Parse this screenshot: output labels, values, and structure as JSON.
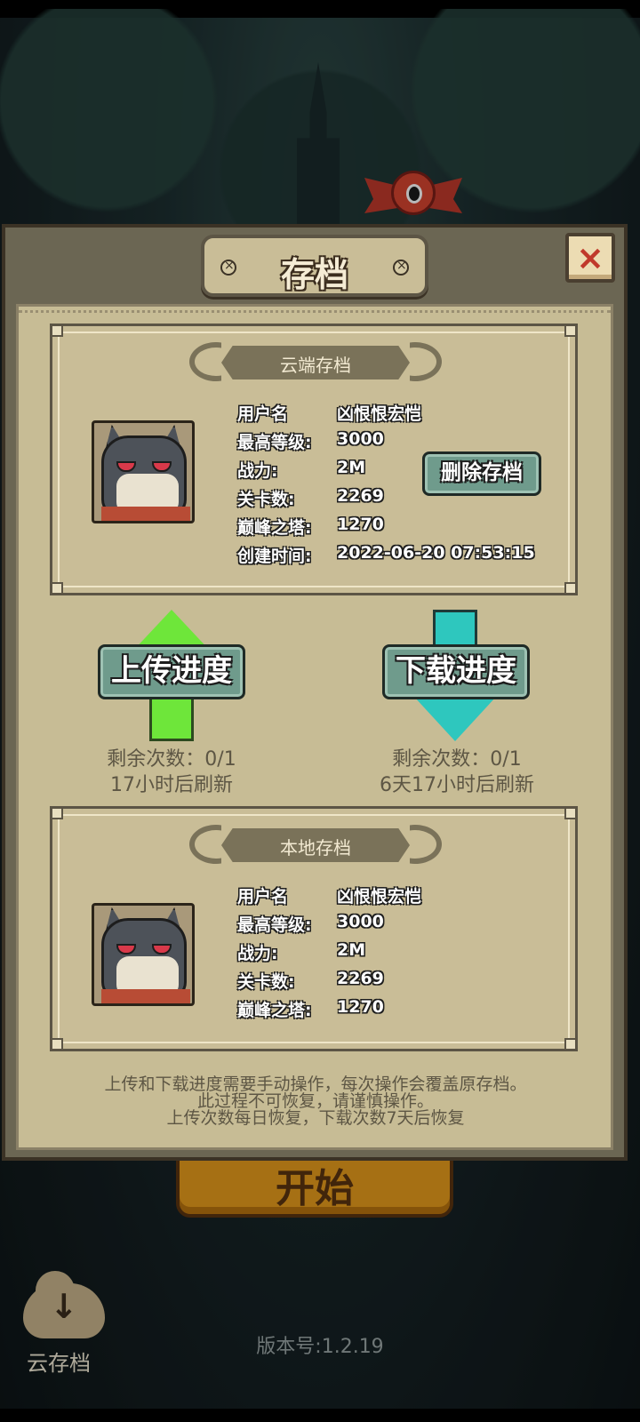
{
  "background": {
    "start_label": "开始",
    "cloud_button_label": "云存档",
    "version": "版本号:1.2.19"
  },
  "dialog": {
    "title": "存档",
    "close_label": "×",
    "cloud_save": {
      "header": "云端存档",
      "rows": [
        {
          "key": "用户名",
          "value": "凶恨恨宏恺"
        },
        {
          "key": "最高等级:",
          "value": "3000"
        },
        {
          "key": "战力:",
          "value": "2M"
        },
        {
          "key": "关卡数:",
          "value": "2269"
        },
        {
          "key": "巅峰之塔:",
          "value": "1270"
        },
        {
          "key": "创建时间:",
          "value": "2022-06-20 07:53:15"
        }
      ],
      "delete_label": "删除存档"
    },
    "upload": {
      "label": "上传进度",
      "remaining": "剩余次数：0/1",
      "refresh": "17小时后刷新"
    },
    "download": {
      "label": "下载进度",
      "remaining": "剩余次数：0/1",
      "refresh": "6天17小时后刷新"
    },
    "local_save": {
      "header": "本地存档",
      "rows": [
        {
          "key": "用户名",
          "value": "凶恨恨宏恺"
        },
        {
          "key": "最高等级:",
          "value": "3000"
        },
        {
          "key": "战力:",
          "value": "2M"
        },
        {
          "key": "关卡数:",
          "value": "2269"
        },
        {
          "key": "巅峰之塔:",
          "value": "1270"
        }
      ]
    },
    "notice": [
      "上传和下载进度需要手动操作，每次操作会覆盖原存档。",
      "此过程不可恢复，请谨慎操作。",
      "上传次数每日恢复，下载次数7天后恢复"
    ]
  },
  "colors": {
    "panel": "#c7bc95",
    "frame": "#6b6653",
    "upload_arrow": "#6ee63a",
    "download_arrow": "#2ec7be",
    "close_x": "#c0392b",
    "button_teal": "#6f9b8c"
  }
}
